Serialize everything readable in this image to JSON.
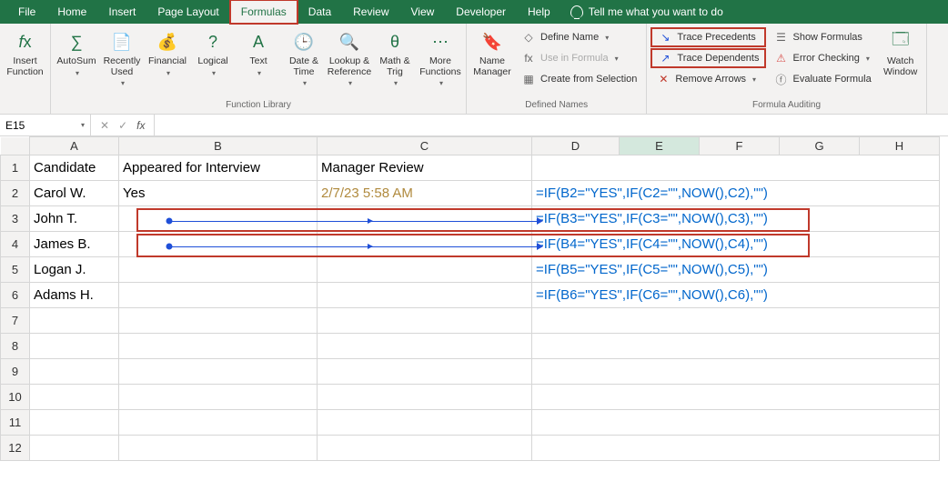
{
  "menu": {
    "tabs": [
      "File",
      "Home",
      "Insert",
      "Page Layout",
      "Formulas",
      "Data",
      "Review",
      "View",
      "Developer",
      "Help"
    ],
    "active": "Formulas",
    "tell_me": "Tell me what you want to do"
  },
  "ribbon": {
    "groups": {
      "fn_single": {
        "insert_function": "Insert\nFunction"
      },
      "library": {
        "label": "Function Library",
        "items": {
          "autosum": "AutoSum",
          "recent": "Recently\nUsed",
          "financial": "Financial",
          "logical": "Logical",
          "text": "Text",
          "date": "Date &\nTime",
          "lookup": "Lookup &\nReference",
          "math": "Math &\nTrig",
          "more": "More\nFunctions"
        }
      },
      "defined": {
        "label": "Defined Names",
        "name_manager": "Name\nManager",
        "define_name": "Define Name",
        "use_in_formula": "Use in Formula",
        "create_from_sel": "Create from Selection"
      },
      "auditing": {
        "label": "Formula Auditing",
        "trace_precedents": "Trace Precedents",
        "trace_dependents": "Trace Dependents",
        "remove_arrows": "Remove Arrows",
        "show_formulas": "Show Formulas",
        "error_checking": "Error Checking",
        "evaluate_formula": "Evaluate Formula",
        "watch_window": "Watch\nWindow"
      }
    }
  },
  "formula_bar": {
    "name_box": "E15",
    "fx_label": "fx",
    "value": ""
  },
  "columns": [
    "A",
    "B",
    "C",
    "D",
    "E",
    "F",
    "G",
    "H"
  ],
  "row_count": 12,
  "active_col": "E",
  "headers": {
    "A": "Candidate",
    "B": "Appeared for Interview",
    "C": "Manager Review"
  },
  "rows": [
    {
      "A": "Carol W.",
      "B": "Yes",
      "C": "2/7/23 5:58 AM",
      "D_formula": "=IF(B2=\"YES\",IF(C2=\"\",NOW(),C2),\"\")"
    },
    {
      "A": "John T.",
      "B": "",
      "C": "",
      "D_formula": "=IF(B3=\"YES\",IF(C3=\"\",NOW(),C3),\"\")"
    },
    {
      "A": "James B.",
      "B": "",
      "C": "",
      "D_formula": "=IF(B4=\"YES\",IF(C4=\"\",NOW(),C4),\"\")"
    },
    {
      "A": "Logan J.",
      "B": "",
      "C": "",
      "D_formula": "=IF(B5=\"YES\",IF(C5=\"\",NOW(),C5),\"\")"
    },
    {
      "A": "Adams H.",
      "B": "",
      "C": "",
      "D_formula": "=IF(B6=\"YES\",IF(C6=\"\",NOW(),C6),\"\")"
    }
  ],
  "colors": {
    "formula_blue": "#0066cc",
    "trace_blue": "#1f4fd8",
    "highlight_red": "#c0392b",
    "excel_green": "#217346"
  }
}
